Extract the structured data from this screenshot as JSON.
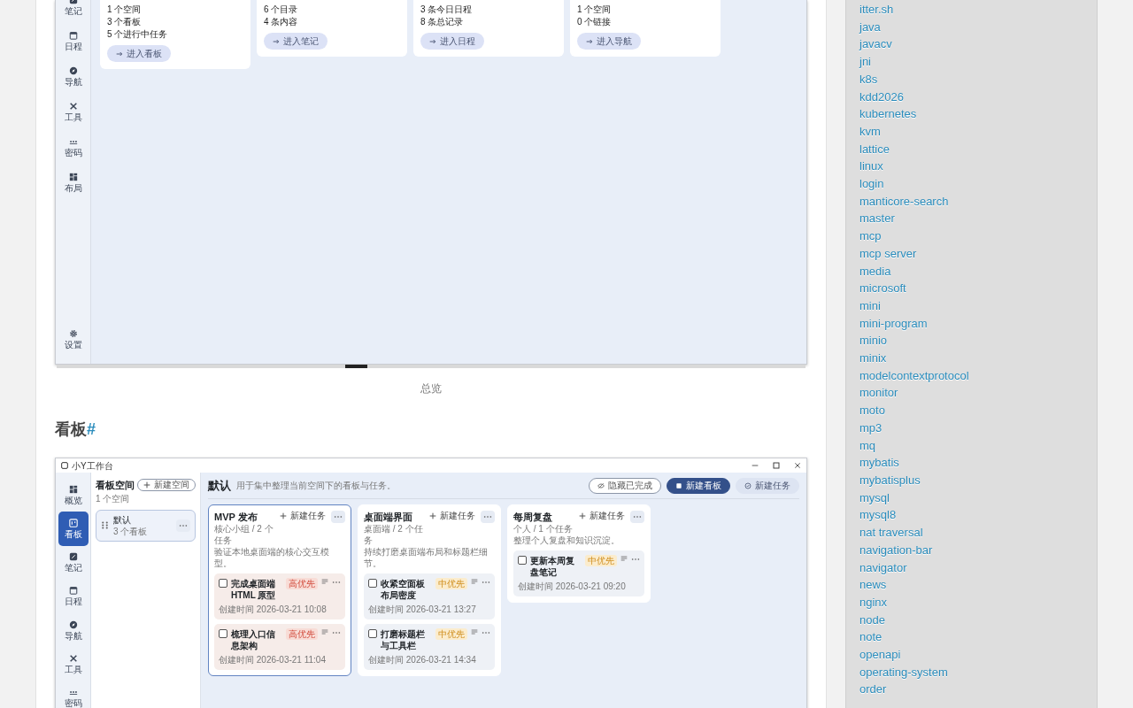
{
  "overview_figure": {
    "nav": [
      {
        "label": "笔记",
        "selected": false
      },
      {
        "label": "日程",
        "selected": false
      },
      {
        "label": "导航",
        "selected": false
      },
      {
        "label": "工具",
        "selected": false
      },
      {
        "label": "密码",
        "selected": false
      },
      {
        "label": "布局",
        "selected": false
      }
    ],
    "settings": {
      "label": "设置"
    },
    "cards": [
      {
        "lines": [
          "1 个空间",
          "3 个看板",
          "5 个进行中任务"
        ],
        "button": "进入看板"
      },
      {
        "lines": [
          "6 个目录",
          "4 条内容"
        ],
        "button": "进入笔记"
      },
      {
        "lines": [
          "3 条今日日程",
          "8 条总记录"
        ],
        "button": "进入日程"
      },
      {
        "lines": [
          "1 个空间",
          "0 个链接"
        ],
        "button": "进入导航"
      }
    ],
    "caption": "总览"
  },
  "section_heading": {
    "text": "看板",
    "anchor": "#"
  },
  "board_figure": {
    "window_title": "小Y工作台",
    "nav": [
      {
        "label": "概览",
        "selected": false
      },
      {
        "label": "看板",
        "selected": true
      },
      {
        "label": "笔记",
        "selected": false
      },
      {
        "label": "日程",
        "selected": false
      },
      {
        "label": "导航",
        "selected": false
      },
      {
        "label": "工具",
        "selected": false
      },
      {
        "label": "密码",
        "selected": false
      }
    ],
    "spaces_panel": {
      "title": "看板空间",
      "new_button": "新建空间",
      "count": "1 个空间",
      "items": [
        {
          "name": "默认",
          "meta": "3 个看板",
          "selected": true
        }
      ]
    },
    "header": {
      "title": "默认",
      "description": "用于集中整理当前空间下的看板与任务。",
      "buttons": [
        {
          "label": "隐藏已完成",
          "kind": "outline"
        },
        {
          "label": "新建看板",
          "kind": "primary"
        },
        {
          "label": "新建任务",
          "kind": "soft"
        }
      ]
    },
    "columns": [
      {
        "title": "MVP 发布",
        "meta": "核心小组 / 2 个任务",
        "add": "新建任务",
        "description": "验证本地桌面端的核心交互模型。",
        "selected": true,
        "tasks": [
          {
            "title": "完成桌面端 HTML 原型",
            "priority": "高优先",
            "kind": "high",
            "checked": false,
            "created": "创建时间 2026-03-21 10:08"
          },
          {
            "title": "梳理入口信息架构",
            "priority": "高优先",
            "kind": "high",
            "checked": false,
            "created": "创建时间 2026-03-21 11:04"
          }
        ]
      },
      {
        "title": "桌面端界面",
        "meta": "桌面端 / 2 个任务",
        "add": "新建任务",
        "description": "持续打磨桌面端布局和标题栏细节。",
        "selected": false,
        "tasks": [
          {
            "title": "收紧空面板布局密度",
            "priority": "中优先",
            "kind": "medium",
            "checked": false,
            "created": "创建时间 2026-03-21 13:27"
          },
          {
            "title": "打磨标题栏与工具栏",
            "priority": "中优先",
            "kind": "medium",
            "checked": false,
            "created": "创建时间 2026-03-21 14:34"
          }
        ]
      },
      {
        "title": "每周复盘",
        "meta": "个人 / 1 个任务",
        "add": "新建任务",
        "description": "整理个人复盘和知识沉淀。",
        "selected": false,
        "tasks": [
          {
            "title": "更新本周复盘笔记",
            "priority": "中优先",
            "kind": "medium",
            "checked": false,
            "created": "创建时间 2026-03-21 09:20"
          }
        ]
      }
    ]
  },
  "tags": [
    "itter.sh",
    "java",
    "javacv",
    "jni",
    "k8s",
    "kdd2026",
    "kubernetes",
    "kvm",
    "lattice",
    "linux",
    "login",
    "manticore-search",
    "master",
    "mcp",
    "mcp server",
    "media",
    "microsoft",
    "mini",
    "mini-program",
    "minio",
    "minix",
    "modelcontextprotocol",
    "monitor",
    "moto",
    "mp3",
    "mq",
    "mybatis",
    "mybatisplus",
    "mysql",
    "mysql8",
    "nat traversal",
    "navigation-bar",
    "navigator",
    "news",
    "nginx",
    "node",
    "note",
    "openapi",
    "operating-system",
    "order"
  ]
}
